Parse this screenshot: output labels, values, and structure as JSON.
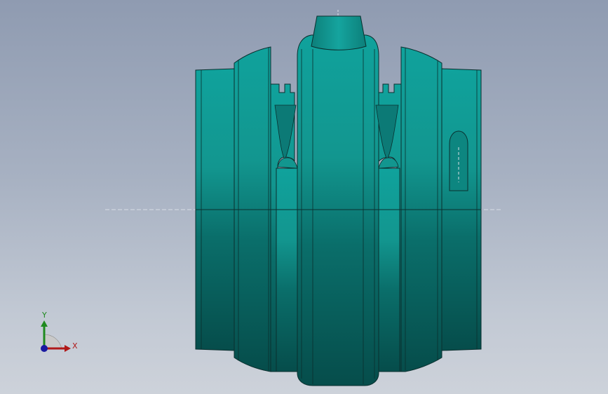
{
  "viewport": {
    "background_top": "#8f9bb1",
    "background_bottom": "#cdd2da"
  },
  "model": {
    "body_color": "#0e8b87",
    "highlight_color": "#17a39d",
    "shadow_color": "#07504d",
    "edge_color": "#0a2f2e"
  },
  "triad": {
    "x_label": "X",
    "y_label": "Y",
    "x_color": "#b01818",
    "y_color": "#1f8a1f",
    "z_color": "#1a1aa0"
  }
}
